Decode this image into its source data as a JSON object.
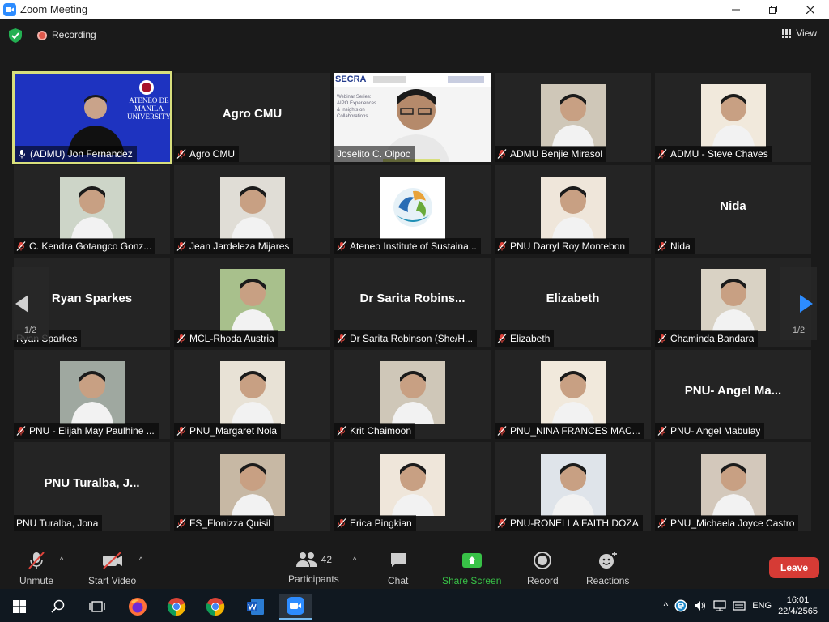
{
  "window": {
    "title": "Zoom Meeting"
  },
  "topbar": {
    "recording_label": "Recording",
    "view_label": "View"
  },
  "colors": {
    "active_border": "#d8df7d",
    "leave": "#d63b35",
    "share_green": "#38c247",
    "rec": "#e0584b"
  },
  "tiles": [
    {
      "name": "(ADMU) Jon Fernandez",
      "type": "video",
      "active": true,
      "icon": "speaking-icon"
    },
    {
      "name": "Agro CMU",
      "bigname": "Agro CMU",
      "icon": "mic-off-icon"
    },
    {
      "name": "Joselito C. Olpoc",
      "type": "video",
      "icon": "none"
    },
    {
      "name": "ADMU Benjie Mirasol",
      "type": "photo",
      "icon": "mic-off-icon"
    },
    {
      "name": "ADMU - Steve Chaves",
      "type": "photo",
      "icon": "mic-off-icon"
    },
    {
      "name": "C. Kendra Gotangco Gonz...",
      "type": "photo",
      "icon": "mic-off-icon"
    },
    {
      "name": "Jean Jardeleza Mijares",
      "type": "photo",
      "icon": "mic-off-icon"
    },
    {
      "name": "Ateneo Institute of Sustaina...",
      "type": "logo",
      "icon": "mic-off-icon"
    },
    {
      "name": "PNU Darryl Roy Montebon",
      "type": "photo",
      "icon": "mic-off-icon"
    },
    {
      "name": "Nida",
      "bigname": "Nida",
      "icon": "mic-off-icon"
    },
    {
      "name": "Ryan Sparkes",
      "bigname": "Ryan Sparkes",
      "icon": "none"
    },
    {
      "name": "MCL-Rhoda Austria",
      "type": "photo",
      "icon": "mic-off-icon"
    },
    {
      "name": "Dr Sarita Robinson (She/H...",
      "bigname": "Dr Sarita Robins...",
      "icon": "mic-off-icon"
    },
    {
      "name": "Elizabeth",
      "bigname": "Elizabeth",
      "icon": "mic-off-icon"
    },
    {
      "name": "Chaminda Bandara",
      "type": "photo",
      "icon": "mic-off-icon"
    },
    {
      "name": "PNU - Elijah May Paulhine ...",
      "type": "photo",
      "icon": "mic-off-icon"
    },
    {
      "name": "PNU_Margaret Nola",
      "type": "photo",
      "icon": "mic-off-icon"
    },
    {
      "name": "Krit Chaimoon",
      "type": "photo",
      "icon": "mic-off-icon"
    },
    {
      "name": "PNU_NINA FRANCES MAC...",
      "type": "photo",
      "icon": "mic-off-icon"
    },
    {
      "name": "PNU- Angel Mabulay",
      "bigname": "PNU- Angel Ma...",
      "icon": "mic-off-icon"
    },
    {
      "name": "PNU  Turalba, Jona",
      "bigname": "PNU  Turalba, J...",
      "icon": "none"
    },
    {
      "name": "FS_Flonizza Quisil",
      "type": "photo",
      "icon": "mic-off-icon"
    },
    {
      "name": "Erica Pingkian",
      "type": "photo",
      "icon": "mic-off-icon"
    },
    {
      "name": "PNU-RONELLA FAITH DOZA",
      "type": "photo",
      "icon": "mic-off-icon"
    },
    {
      "name": "PNU_Michaela Joyce Castro",
      "type": "photo",
      "icon": "mic-off-icon"
    }
  ],
  "video_overlay": {
    "university": "ATENEO DE MANILA UNIVERSITY",
    "secra": "SECRA",
    "slide_text": "Webinar Series: AIPO Experiences & Insights on Collaborations"
  },
  "pagination": {
    "left": "1/2",
    "right": "1/2"
  },
  "toolbar": {
    "unmute": "Unmute",
    "start_video": "Start Video",
    "participants": "Participants",
    "participants_count": "42",
    "chat": "Chat",
    "share_screen": "Share Screen",
    "record": "Record",
    "reactions": "Reactions",
    "leave": "Leave"
  },
  "taskbar": {
    "language": "ENG",
    "time": "16:01",
    "date": "22/4/2565"
  }
}
